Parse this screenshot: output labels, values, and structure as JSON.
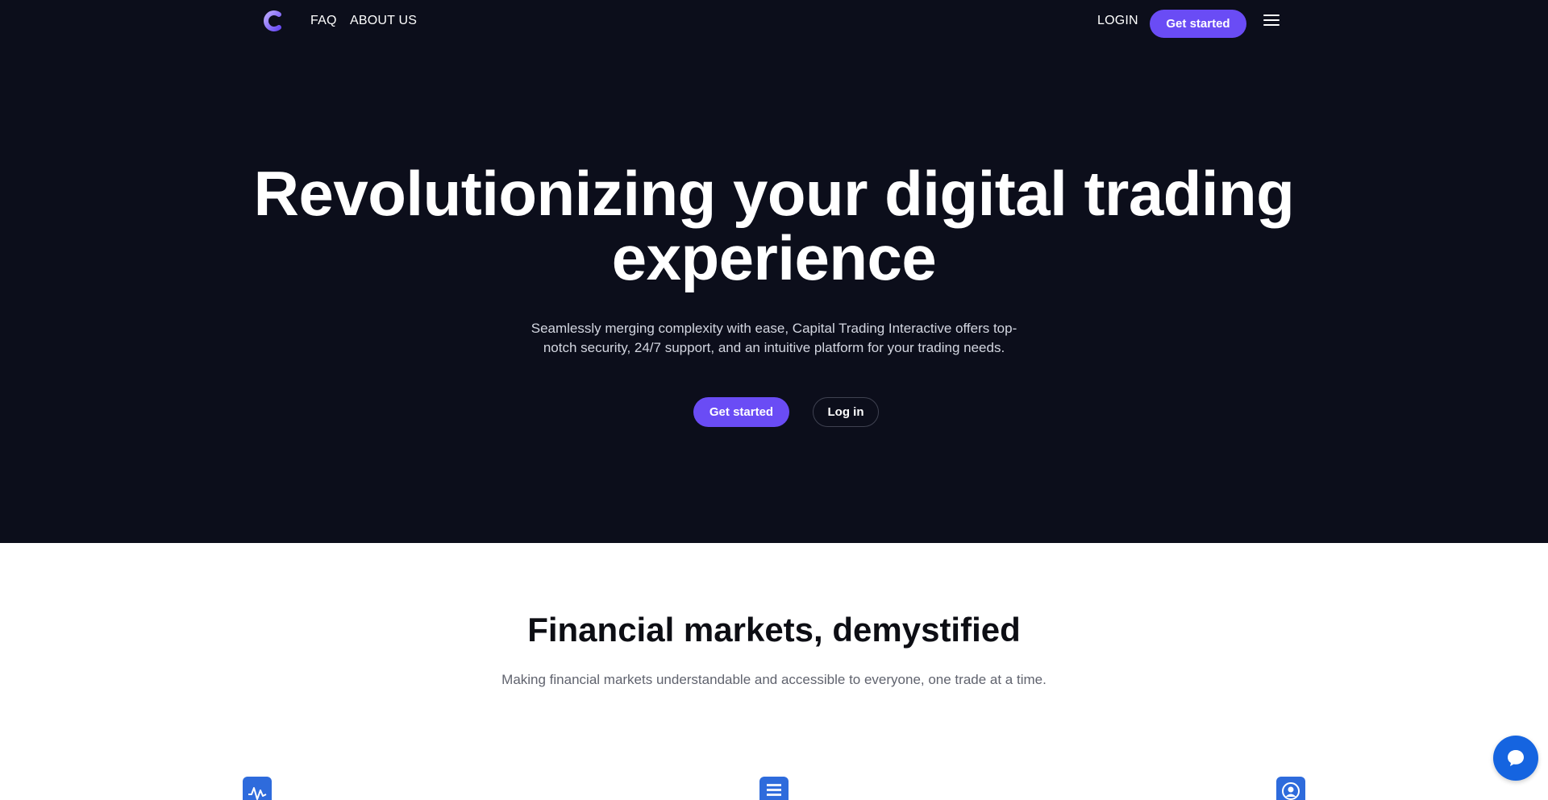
{
  "nav": {
    "faq": "FAQ",
    "about": "ABOUT US",
    "login": "LOGIN",
    "cta": "Get started"
  },
  "hero": {
    "title": "Revolutionizing your digital trading experience",
    "subtitle": "Seamlessly merging complexity with ease, Capital Trading Interactive offers top-notch security, 24/7 support, and an intuitive platform for your trading needs.",
    "primary_button": "Get started",
    "secondary_button": "Log in"
  },
  "features": {
    "title": "Financial markets, demystified",
    "subtitle": "Making financial markets understandable and accessible to everyone, one trade at a time.",
    "icons": [
      "activity-chart-icon",
      "document-list-icon",
      "user-profile-icon"
    ]
  },
  "icons": {
    "logo": "capital-c-logo-icon",
    "menu": "hamburger-menu-icon",
    "chat": "chat-bubble-icon"
  },
  "colors": {
    "hero_background": "#0c0e1b",
    "accent": "#6a4cf5",
    "feature_icon": "#2e6bdc",
    "chat_button": "#1564e0"
  }
}
